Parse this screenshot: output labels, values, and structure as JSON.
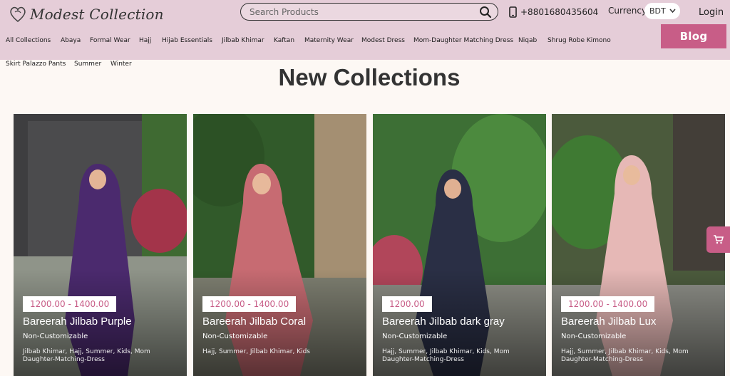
{
  "brand": {
    "logo_text": "Modest Collection"
  },
  "search": {
    "placeholder": "Search Products"
  },
  "contact": {
    "phone": "+8801680435604"
  },
  "currency": {
    "label": "Currency",
    "selected": "BDT"
  },
  "account": {
    "login_label": "Login"
  },
  "nav": {
    "items": [
      "All Collections",
      "Abaya",
      "Formal Wear",
      "Hajj",
      "Hijab Essentials",
      "Jilbab Khimar",
      "Kaftan",
      "Maternity Wear",
      "Modest Dress",
      "Mom-Daughter Matching Dress",
      "Niqab",
      "Shrug Robe Kimono",
      "Skirt Palazzo Pants",
      "Summer",
      "Winter"
    ],
    "blog_label": "Blog"
  },
  "section": {
    "title": "New Collections"
  },
  "products": [
    {
      "price": "1200.00 - 1400.00",
      "name": "Bareerah Jilbab Purple",
      "customization": "Non-Customizable",
      "tags": "Jilbab Khimar, Hajj, Summer, Kids, Mom Daughter-Matching-Dress",
      "color": "#4b2a6e"
    },
    {
      "price": "1200.00 - 1400.00",
      "name": "Bareerah Jilbab Coral",
      "customization": "Non-Customizable",
      "tags": "Hajj, Summer, Jilbab Khimar, Kids",
      "color": "#c76b72"
    },
    {
      "price": "1200.00",
      "name": "Bareerah Jilbab dark gray",
      "customization": "Non-Customizable",
      "tags": "Hajj, Summer, Jilbab Khimar, Kids, Mom Daughter-Matching-Dress",
      "color": "#2a2f45"
    },
    {
      "price": "1200.00 - 1400.00",
      "name": "Bareerah Jilbab Lux",
      "customization": "Non-Customizable",
      "tags": "Hajj, Summer, Jilbab Khimar, Kids, Mom Daughter-Matching-Dress",
      "color": "#e6b8b6"
    }
  ],
  "colors": {
    "accent": "#c85d87",
    "header_bg": "#e5cdd8"
  },
  "icons": {
    "search": "search-icon",
    "phone": "phone-icon",
    "cart": "cart-icon",
    "dropdown": "chevron-down-icon"
  }
}
